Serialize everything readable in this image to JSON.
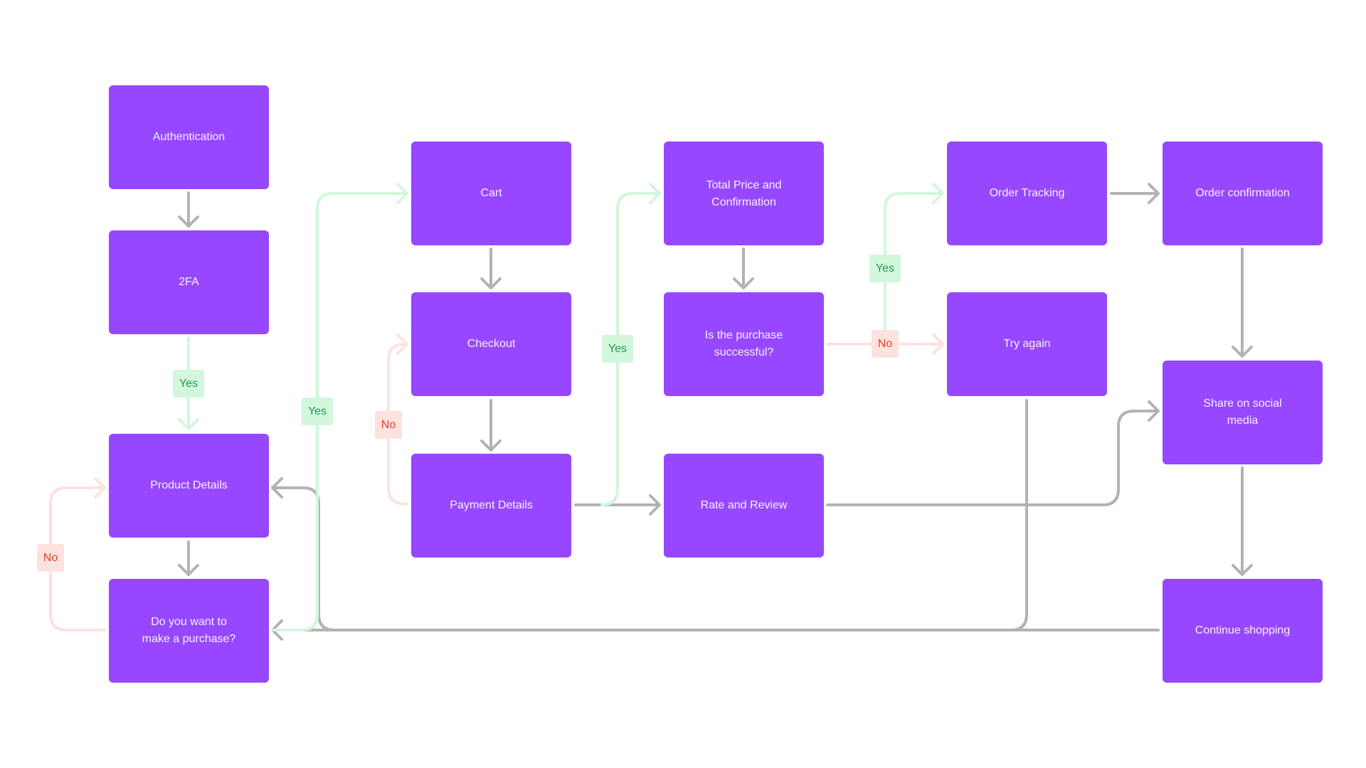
{
  "colors": {
    "node_fill": "#9747ff",
    "node_text": "#f7f2ff",
    "edge_default": "#b3b3b3",
    "edge_yes": "#d2f7dc",
    "edge_no": "#fde2de",
    "label_yes_text": "#1f9a4e",
    "label_no_text": "#d9432f"
  },
  "nodes": {
    "authentication": "Authentication",
    "two_fa": "2FA",
    "product_details": "Product Details",
    "make_purchase": "Do you want to make a purchase?",
    "cart": "Cart",
    "checkout": "Checkout",
    "payment_details": "Payment Details",
    "total_price": "Total Price and Confirmation",
    "purchase_successful": "Is the purchase successful?",
    "rate_review": "Rate and Review",
    "order_tracking": "Order Tracking",
    "try_again": "Try again",
    "order_confirmation": "Order confirmation",
    "share_social": "Share on social media",
    "continue_shopping": "Continue shopping"
  },
  "edge_labels": {
    "twofa_yes": "Yes",
    "purchase_yes": "Yes",
    "purchase_no": "No",
    "payment_no": "No",
    "payment_yes": "Yes",
    "success_yes": "Yes",
    "success_no": "No"
  },
  "edges": [
    {
      "from": "Authentication",
      "to": "2FA",
      "type": "default"
    },
    {
      "from": "2FA",
      "to": "Product Details",
      "type": "yes",
      "label": "Yes"
    },
    {
      "from": "Product Details",
      "to": "Do you want to make a purchase?",
      "type": "default"
    },
    {
      "from": "Do you want to make a purchase?",
      "to": "Product Details",
      "type": "no",
      "label": "No"
    },
    {
      "from": "Do you want to make a purchase?",
      "to": "Cart",
      "type": "yes",
      "label": "Yes"
    },
    {
      "from": "Cart",
      "to": "Checkout",
      "type": "default"
    },
    {
      "from": "Checkout",
      "to": "Payment Details",
      "type": "default"
    },
    {
      "from": "Payment Details",
      "to": "Checkout",
      "type": "no",
      "label": "No"
    },
    {
      "from": "Payment Details",
      "to": "Total Price and Confirmation",
      "type": "yes",
      "label": "Yes"
    },
    {
      "from": "Payment Details",
      "to": "Rate and Review",
      "type": "default"
    },
    {
      "from": "Total Price and Confirmation",
      "to": "Is the purchase successful?",
      "type": "default"
    },
    {
      "from": "Is the purchase successful?",
      "to": "Order Tracking",
      "type": "yes",
      "label": "Yes"
    },
    {
      "from": "Is the purchase successful?",
      "to": "Try again",
      "type": "no",
      "label": "No"
    },
    {
      "from": "Order Tracking",
      "to": "Order confirmation",
      "type": "default"
    },
    {
      "from": "Order confirmation",
      "to": "Share on social media",
      "type": "default"
    },
    {
      "from": "Rate and Review",
      "to": "Share on social media",
      "type": "default"
    },
    {
      "from": "Share on social media",
      "to": "Continue shopping",
      "type": "default"
    },
    {
      "from": "Continue shopping",
      "to": "Product Details",
      "type": "default"
    },
    {
      "from": "Continue shopping",
      "to": "Do you want to make a purchase?",
      "type": "default"
    },
    {
      "from": "Try again",
      "to": "Do you want to make a purchase?",
      "type": "default"
    }
  ]
}
